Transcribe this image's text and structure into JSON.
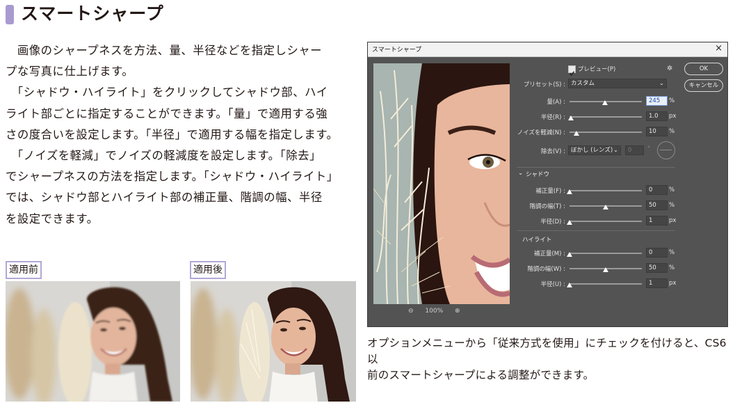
{
  "heading": "スマートシャープ",
  "body_paragraphs": [
    "　画像のシャープネスを方法、量、半径などを指定しシャー",
    "プな写真に仕上げます。",
    "　「シャドウ・ハイライト」をクリックしてシャドウ部、ハイ",
    "ライト部ごとに指定することができます。「量」で適用する強",
    "さの度合いを設定します。「半径」で適用する幅を指定します。",
    "　「ノイズを軽減」でノイズの軽減度を設定します。「除去」",
    "でシャープネスの方法を指定します。「シャドウ・ハイライト」",
    "では、シャドウ部とハイライト部の補正量、階調の幅、半径",
    "を設定できます。"
  ],
  "labels": {
    "before": "適用前",
    "after": "適用後"
  },
  "dialog": {
    "title": "スマートシャープ",
    "close": "×",
    "preview_label": "プレビュー(P)",
    "preview_checked": true,
    "ok": "OK",
    "cancel": "キャンセル",
    "preset_label": "プリセット(S) :",
    "preset_value": "カスタム",
    "amount": {
      "label": "量(A) :",
      "value": "245",
      "unit": "%",
      "level": 0.49
    },
    "radius": {
      "label": "半径(R) :",
      "value": "1.0",
      "unit": "px",
      "level": 0.02
    },
    "noise": {
      "label": "ノイズを軽減(N) :",
      "value": "10",
      "unit": "%",
      "level": 0.1
    },
    "remove_label": "除去(V) :",
    "remove_value": "ぼかし (レンズ)",
    "remove_angle": "0",
    "zoom": "100%",
    "shadow": {
      "title": "シャドウ",
      "fade": {
        "label": "補正量(F) :",
        "value": "0",
        "unit": "%",
        "level": 0.0
      },
      "tonal": {
        "label": "階調の幅(T) :",
        "value": "50",
        "unit": "%",
        "level": 0.5
      },
      "radius": {
        "label": "半径(D) :",
        "value": "1",
        "unit": "px",
        "level": 0.0
      }
    },
    "highlight": {
      "title": "ハイライト",
      "fade": {
        "label": "補正量(M) :",
        "value": "0",
        "unit": "%",
        "level": 0.0
      },
      "tonal": {
        "label": "階調の幅(W) :",
        "value": "50",
        "unit": "%",
        "level": 0.5
      },
      "radius": {
        "label": "半径(U) :",
        "value": "1",
        "unit": "px",
        "level": 0.0
      }
    }
  },
  "caption_lines": [
    "オプションメニューから「従来方式を使用」にチェックを付けると、CS6以",
    "前のスマートシャープによる調整ができます。"
  ]
}
